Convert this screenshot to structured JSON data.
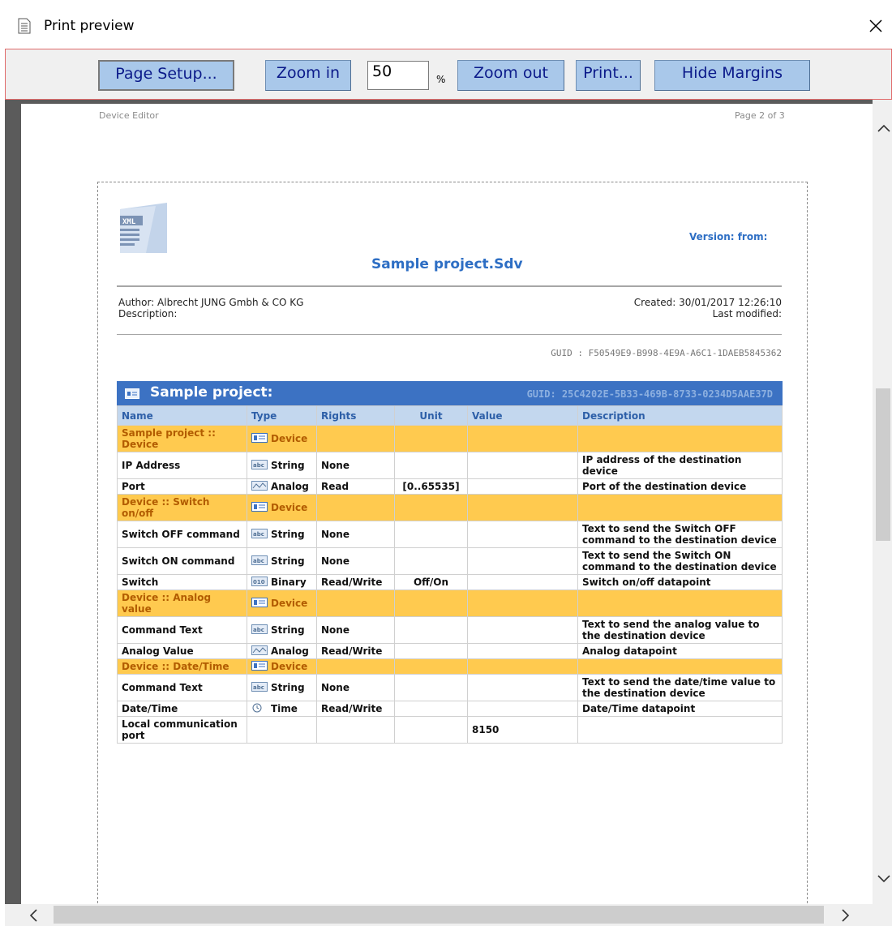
{
  "window": {
    "title": "Print preview"
  },
  "toolbar": {
    "page_setup": "Page Setup...",
    "zoom_in": "Zoom in",
    "zoom_value": "50",
    "zoom_unit": "%",
    "zoom_out": "Zoom out",
    "print": "Print...",
    "hide_margins": "Hide Margins"
  },
  "page": {
    "header_left": "Device Editor",
    "header_right": "Page 2 of 3",
    "version_label": "Version:  from:",
    "project_file": "Sample project.Sdv",
    "author": "Author: Albrecht JUNG Gmbh & CO KG",
    "description": "Description:",
    "created": "Created: 30/01/2017 12:26:10",
    "last_modified": "Last modified:",
    "guid": "GUID : F50549E9-B998-4E9A-A6C1-1DAEB5845362"
  },
  "table": {
    "title": "Sample project:",
    "guid": "GUID: 25C4202E-5B33-469B-8733-0234D5AAE37D",
    "columns": [
      "Name",
      "Type",
      "Rights",
      "Unit",
      "Value",
      "Description"
    ],
    "rows": [
      {
        "group": true,
        "name": "Sample project :: Device",
        "type": "Device"
      },
      {
        "group": false,
        "name": "IP Address",
        "type": "String",
        "rights": "None",
        "unit": "",
        "value": "",
        "description": "IP address of the destination device"
      },
      {
        "group": false,
        "name": "Port",
        "type": "Analog",
        "rights": "Read",
        "unit": "[0..65535]",
        "value": "",
        "description": "Port of the destination device"
      },
      {
        "group": true,
        "name": "Device :: Switch on/off",
        "type": "Device"
      },
      {
        "group": false,
        "name": "Switch OFF command",
        "type": "String",
        "rights": "None",
        "unit": "",
        "value": "",
        "description": "Text to send the Switch OFF command to the destination device"
      },
      {
        "group": false,
        "name": "Switch ON command",
        "type": "String",
        "rights": "None",
        "unit": "",
        "value": "",
        "description": "Text to send the Switch ON command to the destination device"
      },
      {
        "group": false,
        "name": "Switch",
        "type": "Binary",
        "rights": "Read/Write",
        "unit": "Off/On",
        "value": "",
        "description": "Switch on/off datapoint"
      },
      {
        "group": true,
        "name": "Device :: Analog value",
        "type": "Device"
      },
      {
        "group": false,
        "name": "Command Text",
        "type": "String",
        "rights": "None",
        "unit": "",
        "value": "",
        "description": "Text to send the analog value to the destination device"
      },
      {
        "group": false,
        "name": "Analog Value",
        "type": "Analog",
        "rights": "Read/Write",
        "unit": "",
        "value": "",
        "description": "Analog datapoint"
      },
      {
        "group": true,
        "name": "Device :: Date/Time",
        "type": "Device"
      },
      {
        "group": false,
        "name": "Command Text",
        "type": "String",
        "rights": "None",
        "unit": "",
        "value": "",
        "description": "Text to send the date/time value to the destination device"
      },
      {
        "group": false,
        "name": "Date/Time",
        "type": "Time",
        "rights": "Read/Write",
        "unit": "",
        "value": "",
        "description": "Date/Time datapoint"
      },
      {
        "group": false,
        "name": "Local communication port",
        "type": "",
        "rights": "",
        "unit": "",
        "value": "8150",
        "description": ""
      }
    ]
  }
}
